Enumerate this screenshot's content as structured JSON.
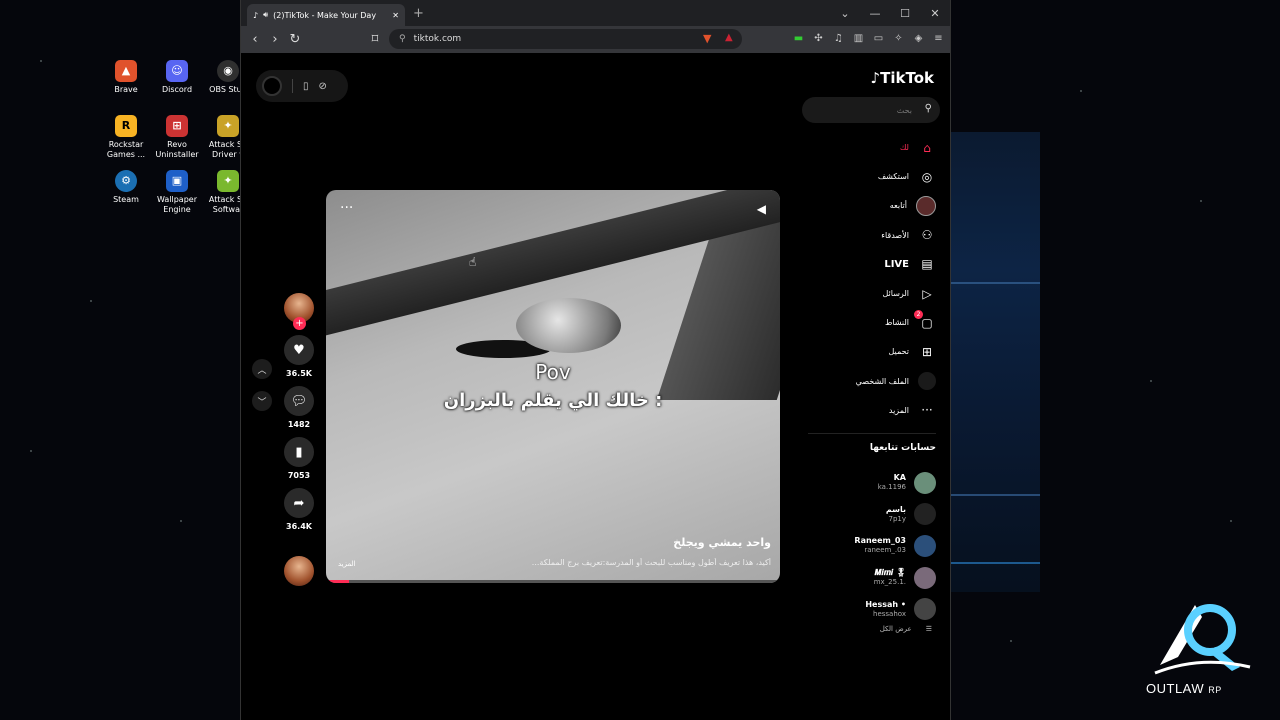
{
  "desktop": {
    "icons": [
      {
        "label": "Brave",
        "icon": "brave-icon",
        "color": "#e0522c"
      },
      {
        "label": "Discord",
        "icon": "discord-icon",
        "color": "#5865f2"
      },
      {
        "label": "OBS Stud",
        "icon": "obs-icon",
        "color": "#2f2f2f"
      },
      {
        "label": "Rockstar Games ...",
        "icon": "rockstar-icon",
        "color": "#f8b324"
      },
      {
        "label": "Revo Uninstaller",
        "icon": "revo-icon",
        "color": "#cc3333"
      },
      {
        "label": "Attack Sh Driver v",
        "icon": "attackshark-icon",
        "color": "#c9a227"
      },
      {
        "label": "Steam",
        "icon": "steam-icon",
        "color": "#1b6fb3"
      },
      {
        "label": "Wallpaper Engine",
        "icon": "wallpaper-engine-icon",
        "color": "#1e5fc8"
      },
      {
        "label": "Attack Sh Softwar",
        "icon": "attackshark-icon",
        "color": "#7ab82e"
      }
    ],
    "watermark": {
      "brand": "OUTLAW",
      "suffix": "RP"
    }
  },
  "browser": {
    "tab_title": "(2)TikTok - Make Your Day",
    "new_tab": "+",
    "url": "tiktok.com"
  },
  "video": {
    "caption_line1": "Pov",
    "caption_line2": "خالك الي يقلم بالبزران :",
    "title": "واحد يمشي ويجلخ",
    "description": "أكيد، هذا تعريف أطول ومناسب للبحث أو المدرسة:تعريف برج المملكة...",
    "more": "المزيد",
    "progress": 0.05
  },
  "actions": {
    "likes": "36.5K",
    "comments": "1482",
    "saves": "7053",
    "shares": "36.4K"
  },
  "sidebar": {
    "logo": "TikTok",
    "search_placeholder": "بحث",
    "nav": [
      {
        "label": "لك",
        "icon": "home-icon"
      },
      {
        "label": "استكشف",
        "icon": "compass-icon"
      },
      {
        "label": "أتابعه",
        "icon": "following-avatar-icon"
      },
      {
        "label": "الأصدقاء",
        "icon": "friends-icon"
      },
      {
        "label": "LIVE",
        "icon": "live-icon"
      },
      {
        "label": "الرسائل",
        "icon": "messages-icon"
      },
      {
        "label": "النشاط",
        "icon": "activity-icon",
        "badge": "2"
      },
      {
        "label": "تحميل",
        "icon": "upload-icon"
      },
      {
        "label": "الملف الشخصي",
        "icon": "profile-icon"
      },
      {
        "label": "المزيد",
        "icon": "more-icon"
      }
    ],
    "following_header": "حسابات تتابعها",
    "following": [
      {
        "name": "KA",
        "handle": "ka.1196"
      },
      {
        "name": "باسم",
        "handle": "7p1y"
      },
      {
        "name": "Raneem_03",
        "handle": "raneem_.03"
      },
      {
        "name": "𝑴𝒊𝒎𝒊 🎖",
        "handle": "mx_25.1."
      },
      {
        "name": "Hessah •",
        "handle": "hessahox"
      }
    ],
    "see_all": "عرض الكل"
  },
  "colors": {
    "accent": "#fe2c55"
  }
}
